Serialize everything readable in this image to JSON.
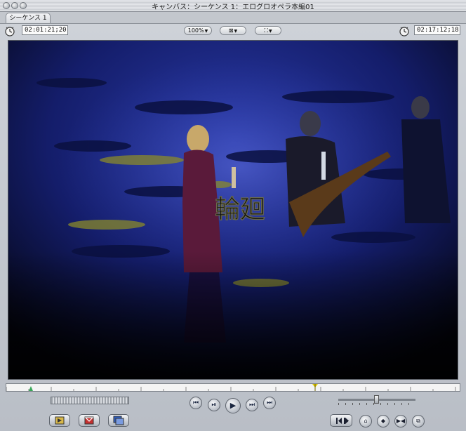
{
  "window": {
    "title": "キャンバス：シーケンス 1：エログロオペラ本編01",
    "tab_label": "シーケンス 1"
  },
  "toolbar": {
    "duration_timecode": "02:01:21;20",
    "zoom_label": "100%",
    "current_timecode": "02:17:12;18"
  },
  "video": {
    "caption": "輪廻"
  },
  "icons": {
    "window_buttons": [
      "close-icon",
      "minimize-icon",
      "zoom-icon"
    ],
    "toolbar": [
      "duration-clock-icon",
      "view-mode-icon",
      "overlay-icon",
      "current-clock-icon"
    ],
    "transport": [
      "go-to-in-icon",
      "play-in-to-out-icon",
      "play-icon",
      "play-around-icon",
      "go-to-out-icon"
    ],
    "edit_buttons": [
      "insert-edit-icon",
      "overwrite-edit-icon",
      "replace-edit-icon"
    ],
    "right_buttons": [
      "previous-edit-icon",
      "add-marker-icon",
      "add-keyframe-icon",
      "mark-clip-icon",
      "match-frame-icon"
    ]
  },
  "colors": {
    "frame_background": "#c9cdd3",
    "stage_blue": "#1a2a8a",
    "playhead": "#e0c800",
    "in_point": "#3aa85a"
  }
}
